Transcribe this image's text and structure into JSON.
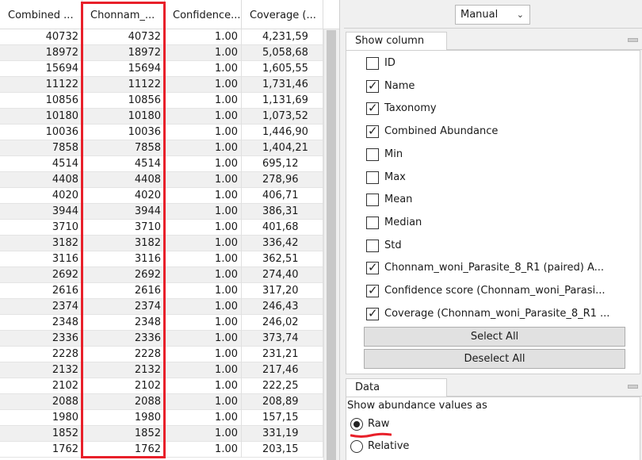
{
  "table": {
    "headers": [
      "Combined ...",
      "Chonnam_...",
      "Confidence...",
      "Coverage (..."
    ],
    "rows": [
      [
        "40732",
        "40732",
        "1.00",
        "4,231,59"
      ],
      [
        "18972",
        "18972",
        "1.00",
        "5,058,68"
      ],
      [
        "15694",
        "15694",
        "1.00",
        "1,605,55"
      ],
      [
        "11122",
        "11122",
        "1.00",
        "1,731,46"
      ],
      [
        "10856",
        "10856",
        "1.00",
        "1,131,69"
      ],
      [
        "10180",
        "10180",
        "1.00",
        "1,073,52"
      ],
      [
        "10036",
        "10036",
        "1.00",
        "1,446,90"
      ],
      [
        "7858",
        "7858",
        "1.00",
        "1,404,21"
      ],
      [
        "4514",
        "4514",
        "1.00",
        "695,12"
      ],
      [
        "4408",
        "4408",
        "1.00",
        "278,96"
      ],
      [
        "4020",
        "4020",
        "1.00",
        "406,71"
      ],
      [
        "3944",
        "3944",
        "1.00",
        "386,31"
      ],
      [
        "3710",
        "3710",
        "1.00",
        "401,68"
      ],
      [
        "3182",
        "3182",
        "1.00",
        "336,42"
      ],
      [
        "3116",
        "3116",
        "1.00",
        "362,51"
      ],
      [
        "2692",
        "2692",
        "1.00",
        "274,40"
      ],
      [
        "2616",
        "2616",
        "1.00",
        "317,20"
      ],
      [
        "2374",
        "2374",
        "1.00",
        "246,43"
      ],
      [
        "2348",
        "2348",
        "1.00",
        "246,02"
      ],
      [
        "2336",
        "2336",
        "1.00",
        "373,74"
      ],
      [
        "2228",
        "2228",
        "1.00",
        "231,21"
      ],
      [
        "2132",
        "2132",
        "1.00",
        "217,46"
      ],
      [
        "2102",
        "2102",
        "1.00",
        "222,25"
      ],
      [
        "2088",
        "2088",
        "1.00",
        "208,89"
      ],
      [
        "1980",
        "1980",
        "1.00",
        "157,15"
      ],
      [
        "1852",
        "1852",
        "1.00",
        "331,19"
      ],
      [
        "1762",
        "1762",
        "1.00",
        "203,15"
      ]
    ]
  },
  "mode_select": {
    "value": "Manual"
  },
  "show_column": {
    "title": "Show column",
    "items": [
      {
        "label": "ID",
        "checked": false
      },
      {
        "label": "Name",
        "checked": true
      },
      {
        "label": "Taxonomy",
        "checked": true
      },
      {
        "label": "Combined Abundance",
        "checked": true
      },
      {
        "label": "Min",
        "checked": false
      },
      {
        "label": "Max",
        "checked": false
      },
      {
        "label": "Mean",
        "checked": false
      },
      {
        "label": "Median",
        "checked": false
      },
      {
        "label": "Std",
        "checked": false
      },
      {
        "label": "Chonnam_woni_Parasite_8_R1 (paired) A...",
        "checked": true
      },
      {
        "label": "Confidence score (Chonnam_woni_Parasi...",
        "checked": true
      },
      {
        "label": "Coverage (Chonnam_woni_Parasite_8_R1 ...",
        "checked": true
      }
    ],
    "select_all_label": "Select All",
    "deselect_all_label": "Deselect All"
  },
  "data_section": {
    "title": "Data",
    "abundance_label": "Show abundance values as",
    "options": [
      {
        "label": "Raw",
        "selected": true
      },
      {
        "label": "Relative",
        "selected": false
      }
    ]
  },
  "colors": {
    "highlight": "#e8202a",
    "panel_bg": "#f0f0f0"
  }
}
